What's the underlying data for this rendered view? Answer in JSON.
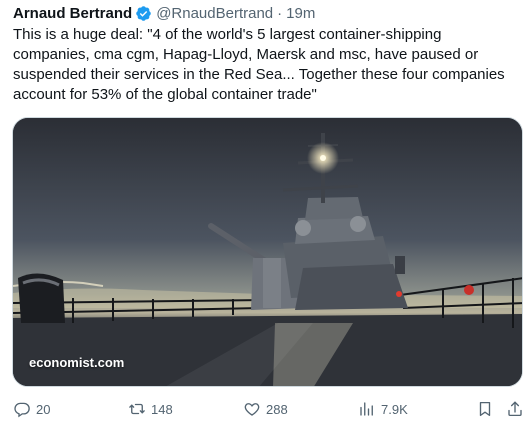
{
  "tweet": {
    "author_name": "Arnaud Bertrand",
    "handle": "@RnaudBertrand",
    "separator": "·",
    "time": "19m",
    "text": "This is a huge deal: \"4 of the world's 5 largest container-shipping companies, cma cgm, Hapag-Lloyd, Maersk and msc, have paused or suspended their services in the Red Sea... Together these four companies account for 53% of the global container trade\"",
    "media": {
      "watermark": "economist.com",
      "description_icon": "warship-photo"
    }
  },
  "actions": {
    "replies": "20",
    "reposts": "148",
    "likes": "288",
    "views": "7.9K"
  },
  "colors": {
    "text": "#0f1419",
    "secondary": "#536471",
    "verified": "#1d9bf0"
  },
  "icons": {
    "reply": "reply-icon",
    "repost": "repost-icon",
    "like": "heart-icon",
    "views": "views-icon",
    "bookmark": "bookmark-icon",
    "share": "share-icon",
    "verified": "verified-badge-icon"
  }
}
